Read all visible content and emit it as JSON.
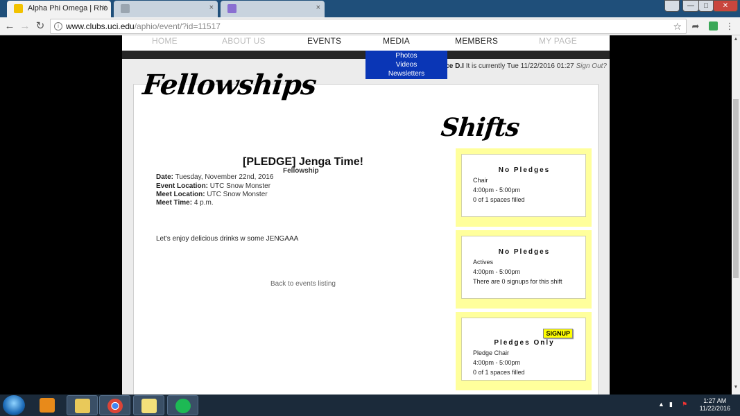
{
  "browser": {
    "tabs": [
      {
        "title": "Alpha Phi Omega | Rho",
        "active": true,
        "close": "×"
      },
      {
        "title": "",
        "active": false,
        "close": "×"
      },
      {
        "title": "",
        "active": false,
        "close": "×"
      }
    ],
    "url_host": "www.clubs.uci.edu",
    "url_path": "/aphio/event/?id=11517",
    "back": "←",
    "forward": "→",
    "reload": "↻",
    "star": "☆",
    "window_buttons": [
      "—",
      "□",
      "✕"
    ]
  },
  "site": {
    "nav": [
      {
        "label": "HOME",
        "dark": false
      },
      {
        "label": "ABOUT US",
        "dark": false
      },
      {
        "label": "EVENTS",
        "dark": true
      },
      {
        "label": "MEDIA",
        "dark": true
      },
      {
        "label": "MEMBERS",
        "dark": true
      },
      {
        "label": "MY PAGE",
        "dark": false
      }
    ],
    "media_dropdown": [
      "Photos",
      "Videos",
      "Newsletters"
    ],
    "userbar": {
      "name": "race D.I",
      "status": "It is currently Tue 11/22/2016 01:27",
      "signout": "Sign Out?"
    },
    "section_heading": "Fellowships",
    "event": {
      "title": "[PLEDGE] Jenga Time!",
      "type": "Fellowship",
      "date_label": "Date:",
      "date_value": "Tuesday, November 22nd, 2016",
      "event_location_label": "Event Location:",
      "event_location_value": "UTC Snow Monster",
      "meet_location_label": "Meet Location:",
      "meet_location_value": "UTC Snow Monster",
      "meet_time_label": "Meet Time:",
      "meet_time_value": "4 p.m.",
      "description": "Let's enjoy delicious drinks w some JENGAAA",
      "back_link": "Back to events listing"
    },
    "shifts_heading": "Shifts",
    "shifts": [
      {
        "title": "No Pledges",
        "role": "Chair",
        "time": "4:00pm - 5:00pm",
        "status": "0 of 1 spaces filled",
        "signup": ""
      },
      {
        "title": "No Pledges",
        "role": "Actives",
        "time": "4:00pm - 5:00pm",
        "status": "There are 0 signups for this shift",
        "signup": ""
      },
      {
        "title": "Pledges Only",
        "role": "Pledge Chair",
        "time": "4:00pm - 5:00pm",
        "status": "0 of 1 spaces filled",
        "signup": "SIGNUP"
      }
    ]
  },
  "taskbar": {
    "time": "1:27 AM",
    "date": "11/22/2016"
  },
  "colors": {
    "dropdown": "#0a36b6",
    "shift_bg": "#ffff9c",
    "signup": "#ffff00"
  }
}
